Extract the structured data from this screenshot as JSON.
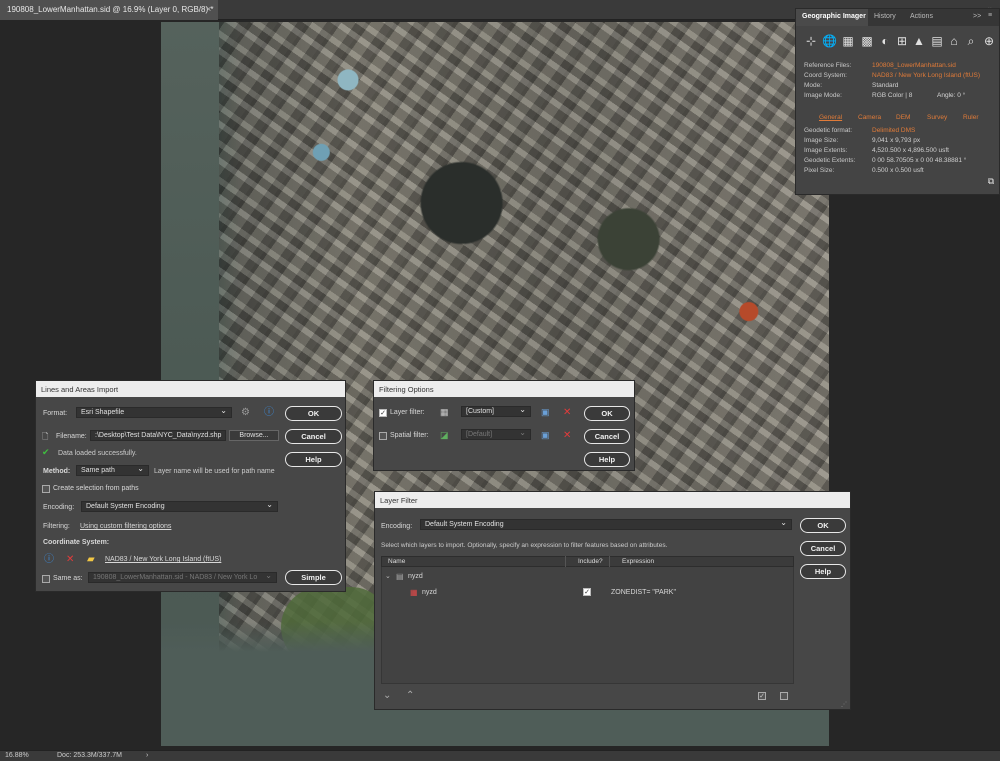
{
  "tab": {
    "title": "190808_LowerManhattan.sid @ 16.9% (Layer 0, RGB/8) *",
    "close": "×",
    "arrow": "»"
  },
  "status": {
    "zoom": "16.88%",
    "doc": "Doc: 253.3M/337.7M",
    "arrow": "›"
  },
  "gi": {
    "tabs": [
      "Geographic Imager",
      "History",
      "Actions"
    ],
    "menu": ">>",
    "info": [
      {
        "k": "Reference Files:",
        "v": "190808_LowerManhattan.sid"
      },
      {
        "k": "Coord System:",
        "v": "NAD83 / New York Long Island (ftUS)"
      },
      {
        "k": "Mode:",
        "v": "Standard"
      },
      {
        "k": "Image Mode:",
        "v": "RGB Color | 8"
      }
    ],
    "angle": "Angle: 0 °",
    "subtabs": [
      "General",
      "Camera",
      "DEM",
      "Survey",
      "Ruler"
    ],
    "details": [
      {
        "k": "Geodetic format:",
        "v": "Delimited DMS"
      },
      {
        "k": "Image Size:",
        "v": "9,041 x 9,793 px"
      },
      {
        "k": "Image Extents:",
        "v": "4,520.500 x 4,896.500 usft"
      },
      {
        "k": "Geodetic Extents:",
        "v": "0 00 58.70505 x 0 00 48.38881 °"
      },
      {
        "k": "Pixel Size:",
        "v": "0.500 x 0.500 usft"
      }
    ]
  },
  "lai": {
    "title": "Lines and Areas Import",
    "format_label": "Format:",
    "format_value": "Esri Shapefile",
    "filename_label": "Filename:",
    "filename_value": ":\\Desktop\\Test Data\\NYC_Data\\nyzd.shp",
    "browse": "Browse...",
    "loaded": "Data loaded successfully.",
    "method_label": "Method:",
    "method_value": "Same path",
    "method_note": "Layer name will be used for path name",
    "create_sel": "Create selection from paths",
    "encoding_label": "Encoding:",
    "encoding_value": "Default System Encoding",
    "filtering_label": "Filtering:",
    "filtering_link": "Using custom filtering options",
    "coord_label": "Coordinate System:",
    "coord_value": "NAD83 / New York Long Island (ftUS)",
    "same_as": "Same as:",
    "same_as_value": "190808_LowerManhattan.sid - NAD83 / New York Lo",
    "ok": "OK",
    "cancel": "Cancel",
    "help": "Help",
    "simple": "Simple"
  },
  "fo": {
    "title": "Filtering Options",
    "layer_label": "Layer filter:",
    "layer_value": "[Custom]",
    "spatial_label": "Spatial filter:",
    "spatial_value": "[Default]",
    "ok": "OK",
    "cancel": "Cancel",
    "help": "Help"
  },
  "lf": {
    "title": "Layer Filter",
    "encoding_label": "Encoding:",
    "encoding_value": "Default System Encoding",
    "desc": "Select which layers to import. Optionally, specify an expression to filter features based on attributes.",
    "cols": [
      "Name",
      "Include?",
      "Expression"
    ],
    "group": "nyzd",
    "layer": "nyzd",
    "expr": "ZONEDIST= \"PARK\"",
    "ok": "OK",
    "cancel": "Cancel",
    "help": "Help"
  }
}
